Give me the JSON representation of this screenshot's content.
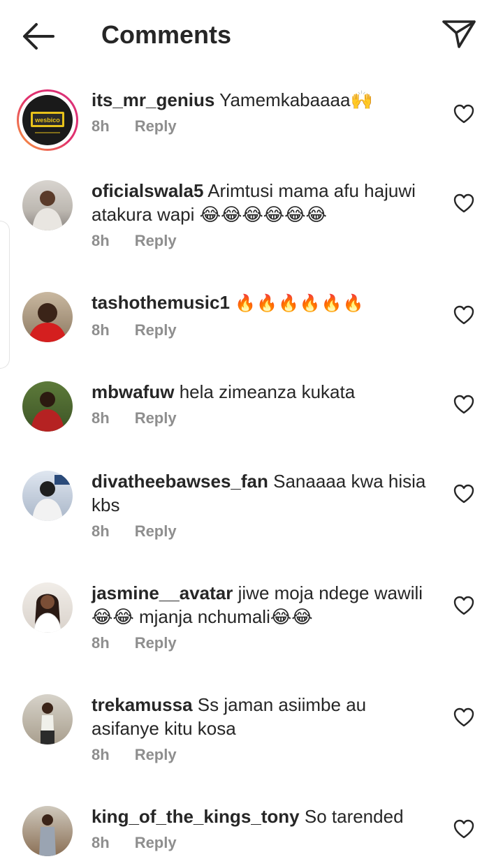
{
  "header": {
    "title": "Comments",
    "back_icon": "arrow-left-icon",
    "share_icon": "paper-plane-icon"
  },
  "colors": {
    "text": "#262626",
    "meta": "#8e8e8e",
    "story_ring_start": "#f9a13a",
    "story_ring_end": "#d9317a"
  },
  "comments": [
    {
      "username": "its_mr_genius",
      "text": "Yamemkabaaaa🙌",
      "time": "8h",
      "reply": "Reply",
      "avatar_text": "wesbico"
    },
    {
      "username": "oficialswala5",
      "text": "Arimtusi mama afu hajuwi atakura wapi 😂😂😂😂😂😂",
      "time": "8h",
      "reply": "Reply"
    },
    {
      "username": "tashothemusic1",
      "text": "🔥🔥🔥🔥🔥🔥",
      "time": "8h",
      "reply": "Reply"
    },
    {
      "username": "mbwafuw",
      "text": "hela zimeanza kukata",
      "time": "8h",
      "reply": "Reply"
    },
    {
      "username": "divatheebawses_fan",
      "text": "Sanaaaa kwa hisia kbs",
      "time": "8h",
      "reply": "Reply"
    },
    {
      "username": "jasmine__avatar",
      "text": "jiwe moja ndege wawili😂😂 mjanja nchumali😂😂",
      "time": "8h",
      "reply": "Reply"
    },
    {
      "username": "trekamussa",
      "text": "Ss jaman asiimbe au asifanye kitu kosa",
      "time": "8h",
      "reply": "Reply"
    },
    {
      "username": "king_of_the_kings_tony",
      "text": "So tarended",
      "time": "8h",
      "reply": "Reply"
    }
  ]
}
